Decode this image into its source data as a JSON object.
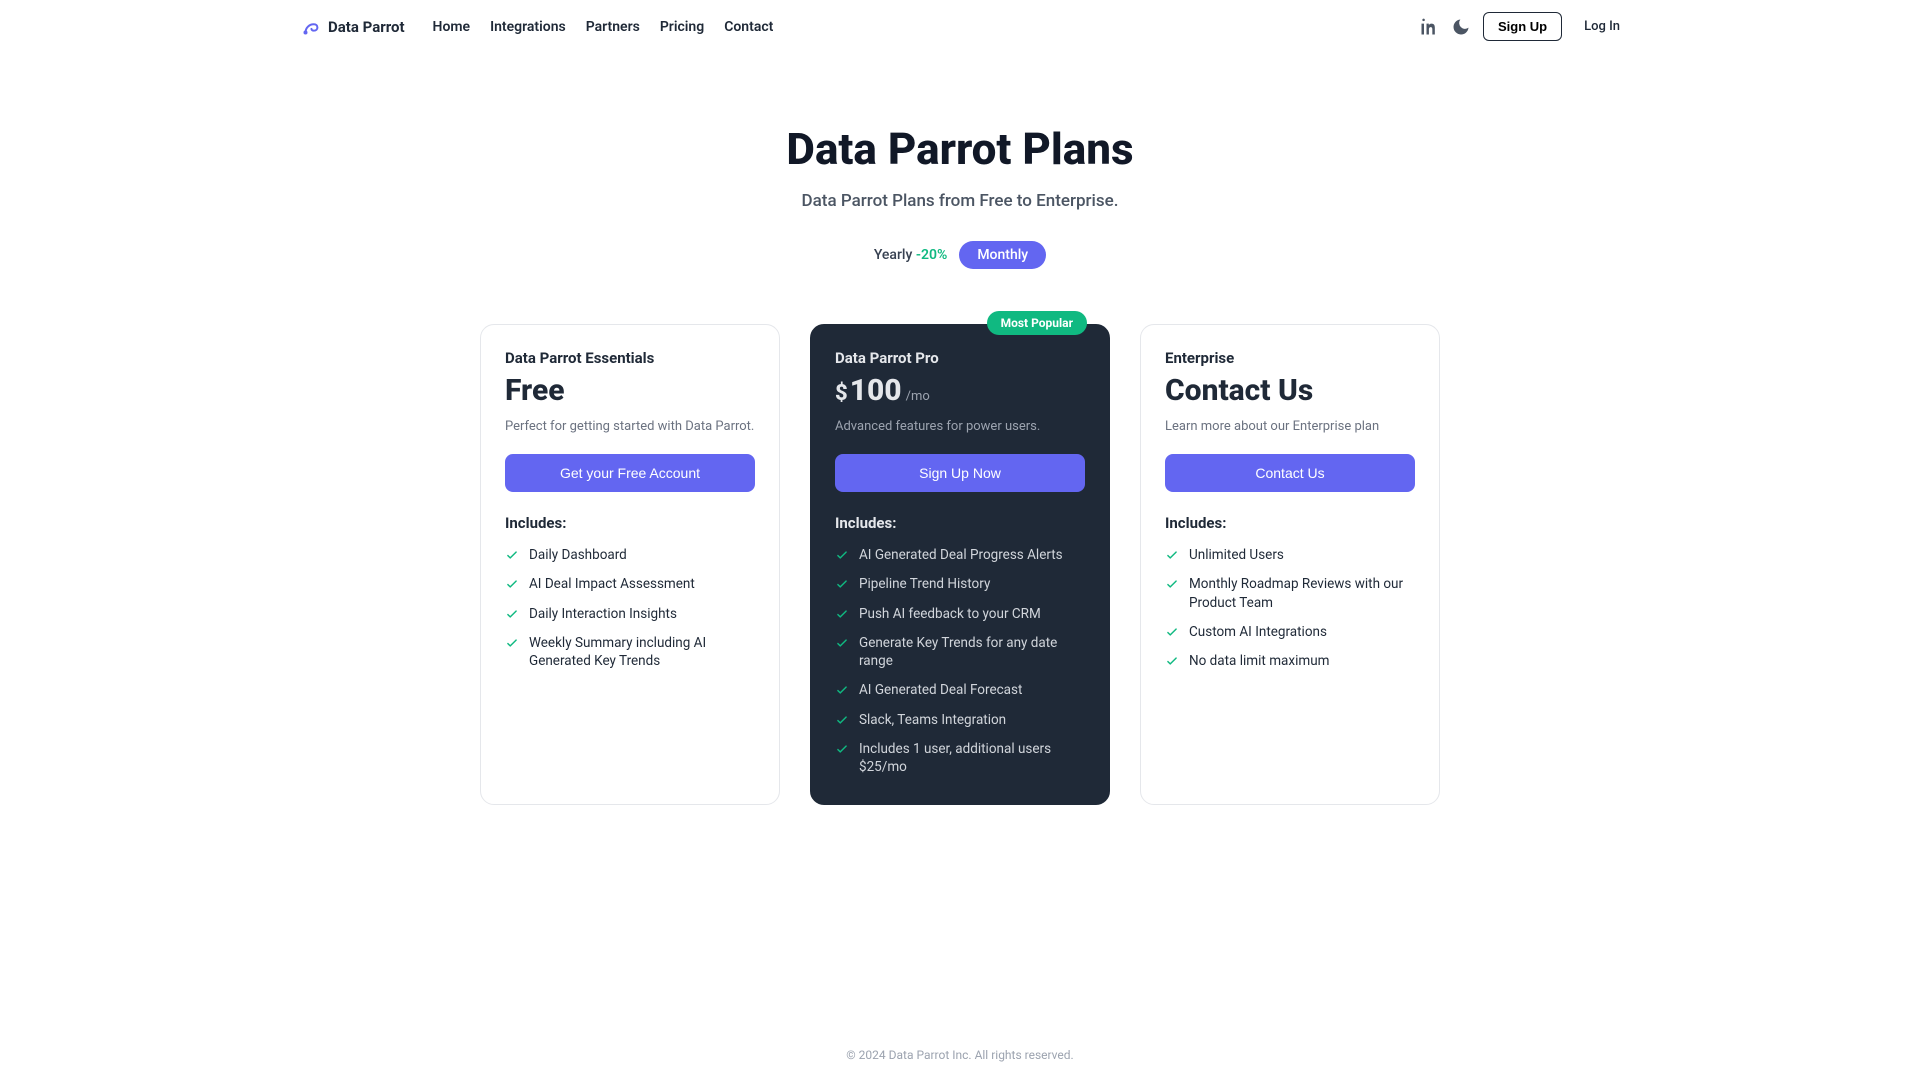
{
  "brand": {
    "name": "Data Parrot"
  },
  "nav": {
    "links": [
      "Home",
      "Integrations",
      "Partners",
      "Pricing",
      "Contact"
    ],
    "signup": "Sign Up",
    "login": "Log In"
  },
  "hero": {
    "title": "Data Parrot Plans",
    "subtitle": "Data Parrot Plans from Free to Enterprise."
  },
  "toggle": {
    "yearly_label": "Yearly",
    "discount": "-20%",
    "monthly_label": "Monthly"
  },
  "badges": {
    "most_popular": "Most Popular"
  },
  "includes_label": "Includes:",
  "plans": [
    {
      "name": "Data Parrot Essentials",
      "price_text": "Free",
      "currency": "",
      "period": "",
      "desc": "Perfect for getting started with Data Parrot.",
      "cta": "Get your Free Account",
      "features": [
        "Daily Dashboard",
        "AI Deal Impact Assessment",
        "Daily Interaction Insights",
        "Weekly Summary including AI Generated Key Trends"
      ]
    },
    {
      "name": "Data Parrot Pro",
      "price_text": "100",
      "currency": "$",
      "period": "/mo",
      "desc": "Advanced features for power users.",
      "cta": "Sign Up Now",
      "features": [
        "AI Generated Deal Progress Alerts",
        "Pipeline Trend History",
        "Push AI feedback to your CRM",
        "Generate Key Trends for any date range",
        "AI Generated Deal Forecast",
        "Slack, Teams Integration",
        "Includes 1 user, additional users $25/mo"
      ]
    },
    {
      "name": "Enterprise",
      "price_text": "Contact Us",
      "currency": "",
      "period": "",
      "desc": "Learn more about our Enterprise plan",
      "cta": "Contact Us",
      "features": [
        "Unlimited Users",
        "Monthly Roadmap Reviews with our Product Team",
        "Custom AI Integrations",
        "No data limit maximum"
      ]
    }
  ],
  "footer": {
    "text": "© 2024 Data Parrot Inc. All rights reserved."
  },
  "colors": {
    "accent": "#6366f1",
    "success": "#10b981",
    "dark_card": "#1f2937"
  }
}
